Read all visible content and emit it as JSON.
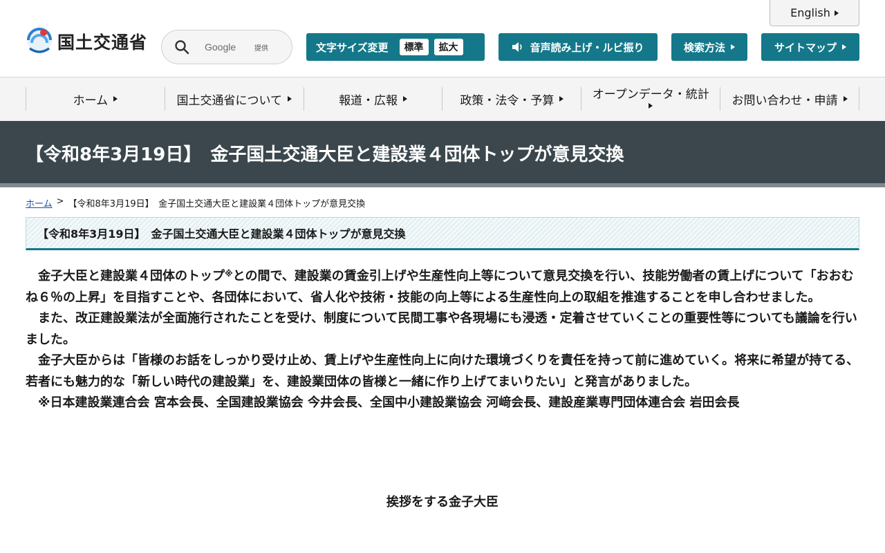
{
  "header": {
    "english_label": "English",
    "logo_text": "国土交通省",
    "search": {
      "placeholder": "Google",
      "provided_label": "提供"
    },
    "font_size": {
      "label": "文字サイズ変更",
      "options": [
        "標準",
        "拡大"
      ]
    },
    "voice_label": "音声読み上げ・ルビ振り",
    "search_method_label": "検索方法",
    "sitemap_label": "サイトマップ"
  },
  "nav": {
    "items": [
      {
        "label": "ホーム"
      },
      {
        "label": "国土交通省について"
      },
      {
        "label": "報道・広報"
      },
      {
        "label": "政策・法令・予算"
      },
      {
        "label": "オープンデータ・統計"
      },
      {
        "label": "お問い合わせ・申請"
      }
    ]
  },
  "page": {
    "title": "【令和8年3月19日】　金子国土交通大臣と建設業４団体トップが意見交換",
    "breadcrumb": {
      "home": "ホーム",
      "separator": ">",
      "current": "【令和8年3月19日】　金子国土交通大臣と建設業４団体トップが意見交換"
    },
    "heading": "【令和8年3月19日】　金子国土交通大臣と建設業４団体トップが意見交換",
    "paragraphs": {
      "p1_a": "金子大臣と建設業４団体のトップ",
      "p1_mark": "※",
      "p1_b": "との間で、建設業の賃金引上げや生産性向上等について意見交換を行い、技能労働者の賃上げについて「おおむね６％の上昇」を目指すことや、各団体において、省人化や技術・技能の向上等による生産性向上の取組を推進することを申し合わせました。",
      "p2": "また、改正建設業法が全面施行されたことを受け、制度について民間工事や各現場にも浸透・定着させていくことの重要性等についても議論を行いました。",
      "p3": "金子大臣からは「皆様のお話をしっかり受け止め、賃上げや生産性向上に向けた環境づくりを責任を持って前に進めていく。将来に希望が持てる、若者にも魅力的な「新しい時代の建設業」を、建設業団体の皆様と一緒に作り上げてまいりたい」と発言がありました。",
      "p4": "※日本建設業連合会 宮本会長、全国建設業協会 今井会長、全国中小建設業協会 河﨑会長、建設産業専門団体連合会 岩田会長"
    },
    "caption": "挨拶をする金子大臣"
  }
}
